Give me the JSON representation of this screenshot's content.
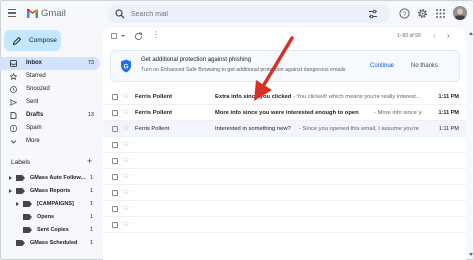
{
  "app": {
    "name": "Gmail"
  },
  "search": {
    "placeholder": "Search mail"
  },
  "compose": {
    "label": "Compose"
  },
  "nav": [
    {
      "id": "inbox",
      "label": "Inbox",
      "count": "73",
      "active": true
    },
    {
      "id": "starred",
      "label": "Starred",
      "count": ""
    },
    {
      "id": "snoozed",
      "label": "Snoozed",
      "count": ""
    },
    {
      "id": "sent",
      "label": "Sent",
      "count": ""
    },
    {
      "id": "drafts",
      "label": "Drafts",
      "count": "13",
      "bold": true
    },
    {
      "id": "spam",
      "label": "Spam",
      "count": ""
    },
    {
      "id": "more",
      "label": "More",
      "count": ""
    }
  ],
  "labels": {
    "heading": "Labels",
    "items": [
      {
        "label": "GMass Auto Follow...",
        "count": "1"
      },
      {
        "label": "GMass Reports",
        "count": "1"
      },
      {
        "label": "[CAMPAIGNS]",
        "count": "1"
      },
      {
        "label": "Opens",
        "count": "1"
      },
      {
        "label": "Sent Copies",
        "count": "1"
      },
      {
        "label": "GMass Scheduled",
        "count": "1"
      }
    ]
  },
  "toolbar": {
    "pager": "1–50 of 93"
  },
  "banner": {
    "title": "Get additional protection against phishing",
    "subtitle": "Turn on Enhanced Safe Browsing to get additional protection against dangerous emails",
    "continue_label": "Continue",
    "dismiss_label": "No thanks"
  },
  "emails": [
    {
      "sender": "Ferris Pollent",
      "subject": "Extra info since you clicked",
      "snippet": "- You clicked! which means you're really interest...",
      "time": "1:11 PM",
      "read": false
    },
    {
      "sender": "Ferris Pollent",
      "subject": "More info since you were interested enough to open",
      "snippet": "- More info since you'...",
      "time": "1:11 PM",
      "read": false
    },
    {
      "sender": "Ferris Pollent",
      "subject": "Interested in something new?",
      "snippet": "- Since you opened this email, I assume you're i...",
      "time": "1:11 PM",
      "read": true
    },
    {
      "sender": "",
      "subject": "",
      "snippet": "",
      "time": "",
      "read": false
    },
    {
      "sender": "",
      "subject": "",
      "snippet": "",
      "time": "",
      "read": false
    },
    {
      "sender": "",
      "subject": "",
      "snippet": "",
      "time": "",
      "read": false
    },
    {
      "sender": "",
      "subject": "",
      "snippet": "",
      "time": "",
      "read": false
    },
    {
      "sender": "",
      "subject": "",
      "snippet": "",
      "time": "",
      "read": false
    },
    {
      "sender": "",
      "subject": "",
      "snippet": "",
      "time": "",
      "read": false
    }
  ],
  "annotation": {
    "color": "#d93025"
  },
  "colors": {
    "accent": "#0b57d0",
    "compose_bg": "#c2e7ff",
    "active_nav": "#d3e3fd",
    "app_bg": "#f6f8fc"
  }
}
